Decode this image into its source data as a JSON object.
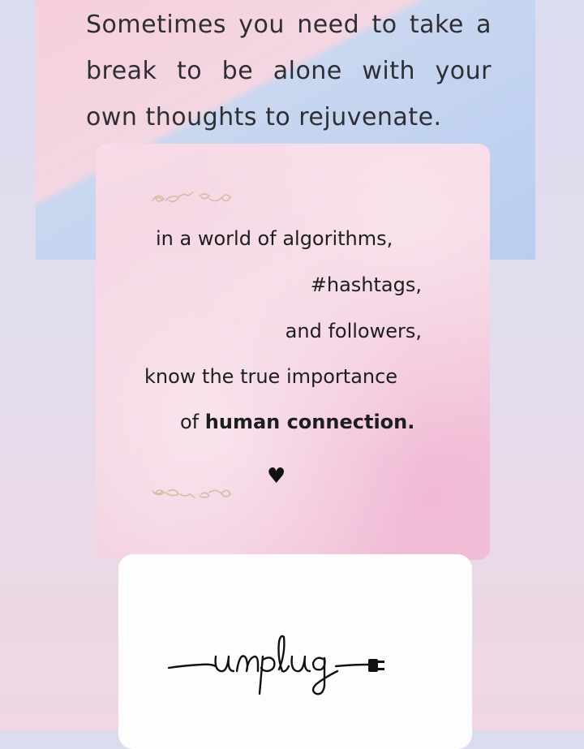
{
  "top_quote": {
    "lines": [
      "Sometimes you need to take a",
      "break to be alone with your",
      "own thoughts to rejuvenate."
    ]
  },
  "middle_card": {
    "lines": [
      "in a world of algorithms,",
      "#hashtags,",
      "and followers,",
      "know the true importance"
    ],
    "last_line_prefix": "of ",
    "last_line_bold": "human connection.",
    "heart": "♥",
    "flourish_icon": "scroll-flourish-icon"
  },
  "bottom_card": {
    "logo_text": "unplug",
    "logo_icon": "plug-icon"
  },
  "colors": {
    "pink": "#f6cfdc",
    "blue": "#b9cdef",
    "card_pink": "#f4d2e1",
    "text": "#1e1e20",
    "flourish": "#d9bba1"
  }
}
